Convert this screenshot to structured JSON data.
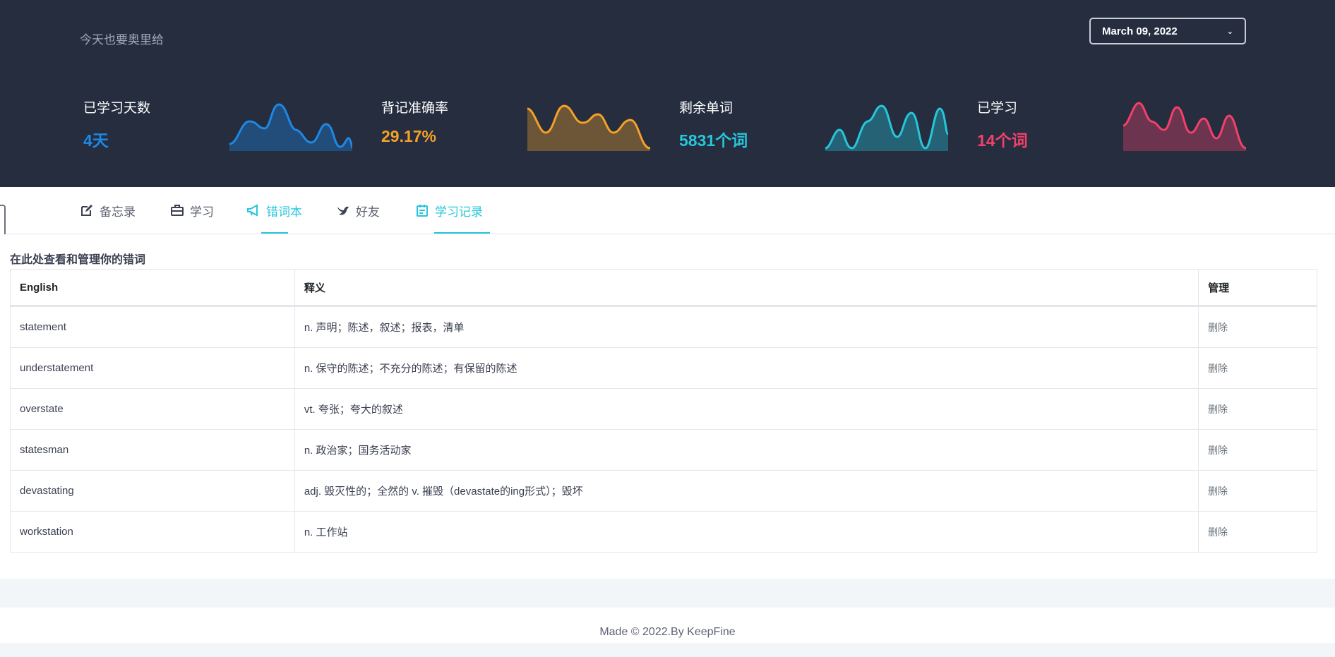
{
  "header": {
    "tagline": "今天也要奥里给",
    "date": "March 09, 2022",
    "stats": [
      {
        "label": "已学习天数",
        "value": "4天",
        "color": "#1e88e5"
      },
      {
        "label": "背记准确率",
        "value": "29.17%",
        "color": "#f4a127"
      },
      {
        "label": "剩余单词",
        "value": "5831个词",
        "color": "#26c6da"
      },
      {
        "label": "已学习",
        "value": "14个词",
        "color": "#f2416a"
      }
    ]
  },
  "nav": {
    "tabs": [
      {
        "label": "备忘录",
        "icon": "edit-icon",
        "active": false
      },
      {
        "label": "学习",
        "icon": "briefcase-icon",
        "active": false
      },
      {
        "label": "错词本",
        "icon": "megaphone-icon",
        "active": true
      },
      {
        "label": "好友",
        "icon": "bird-icon",
        "active": false
      },
      {
        "label": "学习记录",
        "icon": "calendar-icon",
        "active": true
      }
    ]
  },
  "main": {
    "title": "在此处查看和管理你的错词",
    "columns": [
      "English",
      "释义",
      "管理"
    ],
    "rows": [
      {
        "word": "statement",
        "meaning": "n. 声明；陈述，叙述；报表，清单",
        "action": "删除"
      },
      {
        "word": "understatement",
        "meaning": "n. 保守的陈述；不充分的陈述；有保留的陈述",
        "action": "删除"
      },
      {
        "word": "overstate",
        "meaning": "vt. 夸张；夸大的叙述",
        "action": "删除"
      },
      {
        "word": "statesman",
        "meaning": "n. 政治家；国务活动家",
        "action": "删除"
      },
      {
        "word": "devastating",
        "meaning": "adj. 毁灭性的；全然的 v. 摧毁（devastate的ing形式）；毁坏",
        "action": "删除"
      },
      {
        "word": "workstation",
        "meaning": "n. 工作站",
        "action": "删除"
      }
    ]
  },
  "footer": {
    "text": "Made © 2022.By KeepFine"
  }
}
